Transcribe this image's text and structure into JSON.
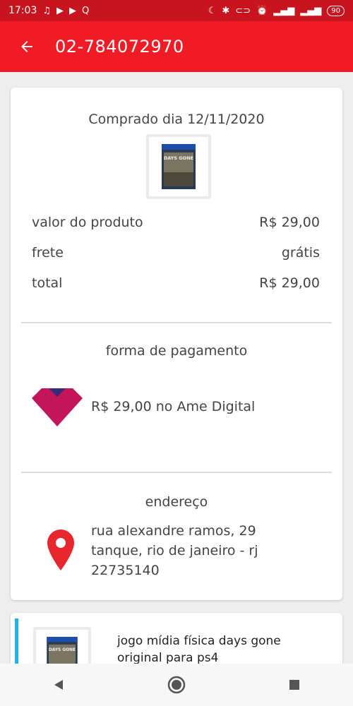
{
  "status_bar": {
    "time": "17:03",
    "battery": "90"
  },
  "app_bar": {
    "title": "02-784072970"
  },
  "order": {
    "purchase_date": "Comprado dia 12/11/2020",
    "product_cover_text": "DAYS GONE",
    "rows": [
      {
        "label": "valor do produto",
        "value": "R$ 29,00"
      },
      {
        "label": "frete",
        "value": "grátis"
      },
      {
        "label": "total",
        "value": "R$ 29,00"
      }
    ]
  },
  "payment": {
    "title": "forma de pagamento",
    "text": "R$ 29,00 no Ame Digital",
    "logo_color": "#c2155a"
  },
  "address": {
    "title": "endereço",
    "line1": "rua alexandre ramos, 29",
    "line2": "tanque, rio de janeiro - rj",
    "line3": "22735140",
    "pin_color": "#e8262d"
  },
  "item": {
    "title": "jogo mídia física days gone original para ps4",
    "accent_color": "#1fb3e8"
  },
  "colors": {
    "app_bar": "#f01b24",
    "status_bar": "#c8141e"
  }
}
